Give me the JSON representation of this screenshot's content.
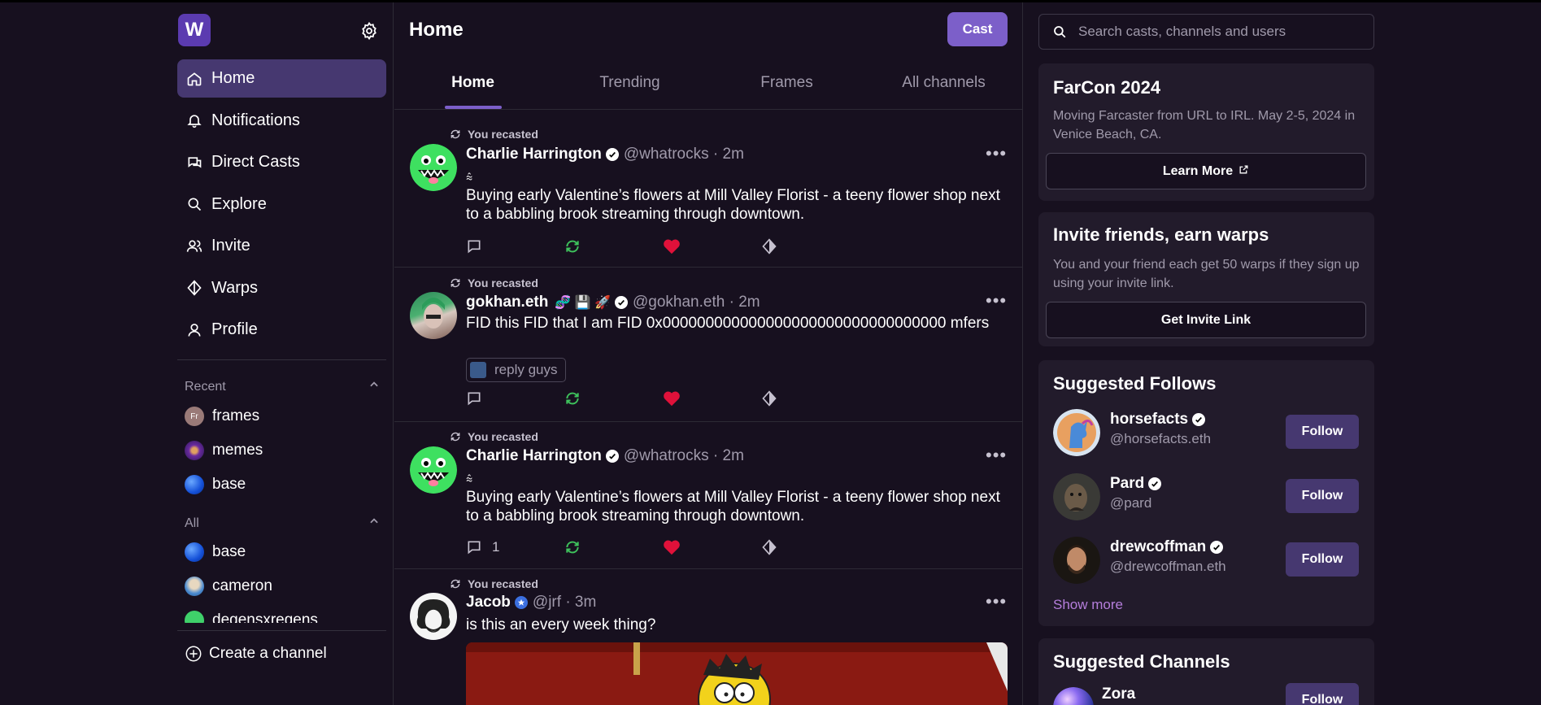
{
  "brand": {
    "logo_letter": "W",
    "accent": "#7c5fc9",
    "active_bg": "#463870"
  },
  "nav": {
    "items": [
      {
        "label": "Home",
        "icon": "home-icon",
        "active": true
      },
      {
        "label": "Notifications",
        "icon": "bell-icon"
      },
      {
        "label": "Direct Casts",
        "icon": "chat-icon"
      },
      {
        "label": "Explore",
        "icon": "search-icon"
      },
      {
        "label": "Invite",
        "icon": "users-icon"
      },
      {
        "label": "Warps",
        "icon": "diamond-icon"
      },
      {
        "label": "Profile",
        "icon": "user-icon"
      }
    ]
  },
  "recent": {
    "title": "Recent",
    "items": [
      {
        "label": "frames",
        "avatar_text": "Fr"
      },
      {
        "label": "memes"
      },
      {
        "label": "base"
      }
    ]
  },
  "all": {
    "title": "All",
    "items": [
      {
        "label": "base"
      },
      {
        "label": "cameron"
      },
      {
        "label": "degensxregens"
      }
    ]
  },
  "create_channel": "Create a channel",
  "header": {
    "title": "Home",
    "cast_label": "Cast"
  },
  "tabs": [
    {
      "label": "Home",
      "active": true
    },
    {
      "label": "Trending"
    },
    {
      "label": "Frames"
    },
    {
      "label": "All channels"
    }
  ],
  "posts": [
    {
      "recast_label": "You recasted",
      "name": "Charlie Harrington",
      "meta": "@whatrocks · 2m",
      "glyph": "⩯",
      "text": "Buying early Valentine’s flowers at Mill Valley Florist - a teeny flower shop next to a babbling brook streaming through downtown.",
      "replies": ""
    },
    {
      "recast_label": "You recasted",
      "name": "gokhan.eth",
      "name_emoji": "🧬 💾 🚀",
      "meta": "@gokhan.eth · 2m",
      "text": "FID this FID that I am FID 0x000000000000000000000000000000000 mfers",
      "channel_chip": "reply guys",
      "replies": ""
    },
    {
      "recast_label": "You recasted",
      "name": "Charlie Harrington",
      "meta": "@whatrocks · 2m",
      "glyph": "⩯",
      "text": "Buying early Valentine’s flowers at Mill Valley Florist - a teeny flower shop next to a babbling brook streaming through downtown.",
      "replies": "1"
    },
    {
      "recast_label": "You recasted",
      "name": "Jacob",
      "meta": "@jrf · 3m",
      "text": "is this an every week thing?",
      "replies": ""
    }
  ],
  "search": {
    "placeholder": "Search casts, channels and users"
  },
  "farcon": {
    "title": "FarCon 2024",
    "text": "Moving Farcaster from URL to IRL. May 2-5, 2024 in Venice Beach, CA.",
    "button": "Learn More"
  },
  "invite": {
    "title": "Invite friends, earn warps",
    "text": "You and your friend each get 50 warps if they sign up using your invite link.",
    "button": "Get Invite Link"
  },
  "suggested_follows": {
    "title": "Suggested Follows",
    "items": [
      {
        "name": "horsefacts",
        "handle": "@horsefacts.eth",
        "button": "Follow"
      },
      {
        "name": "Pard",
        "handle": "@pard",
        "button": "Follow"
      },
      {
        "name": "drewcoffman",
        "handle": "@drewcoffman.eth",
        "button": "Follow"
      }
    ],
    "show_more": "Show more"
  },
  "suggested_channels": {
    "title": "Suggested Channels",
    "items": [
      {
        "name": "Zora",
        "button": "Follow"
      }
    ]
  }
}
